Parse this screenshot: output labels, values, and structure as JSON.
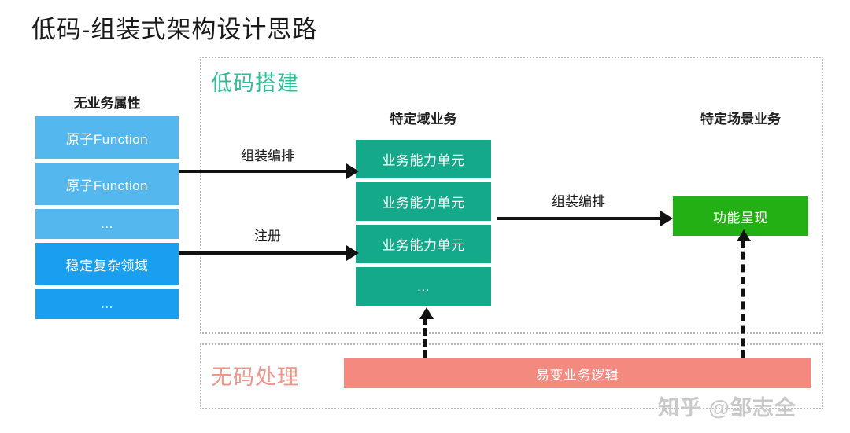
{
  "page": {
    "title": "低码-组装式架构设计思路",
    "background_color": "#ffffff",
    "watermark": "知乎 @邹志全"
  },
  "regions": {
    "lowcode": {
      "title": "低码搭建",
      "title_color": "#2fbd97",
      "border_style": "dotted"
    },
    "nocode": {
      "title": "无码处理",
      "title_color": "#f1948a",
      "border_style": "dotted"
    }
  },
  "columns": {
    "left": {
      "heading": "无业务属性",
      "boxes": [
        {
          "label": "原子Function",
          "color": "#54b8ee"
        },
        {
          "label": "原子Function",
          "color": "#54b8ee"
        },
        {
          "label": "...",
          "color": "#54b8ee"
        },
        {
          "label": "稳定复杂领域",
          "color": "#1a9ef0"
        },
        {
          "label": "...",
          "color": "#1a9ef0"
        }
      ]
    },
    "middle": {
      "heading": "特定域业务",
      "boxes": [
        {
          "label": "业务能力单元",
          "color": "#13a98a"
        },
        {
          "label": "业务能力单元",
          "color": "#13a98a"
        },
        {
          "label": "业务能力单元",
          "color": "#13a98a"
        },
        {
          "label": "...",
          "color": "#13a98a"
        }
      ]
    },
    "right": {
      "heading": "特定场景业务",
      "boxes": [
        {
          "label": "功能呈现",
          "color": "#22b014"
        }
      ]
    }
  },
  "bottom_bar": {
    "label": "易变业务逻辑",
    "color": "#f4897f"
  },
  "arrows": [
    {
      "name": "assemble-1",
      "label": "组装编排",
      "style": "solid",
      "direction": "right"
    },
    {
      "name": "register",
      "label": "注册",
      "style": "solid",
      "direction": "right"
    },
    {
      "name": "assemble-2",
      "label": "组装编排",
      "style": "solid",
      "direction": "right"
    },
    {
      "name": "volatile-to-domain",
      "label": "",
      "style": "dashed",
      "direction": "up"
    },
    {
      "name": "volatile-to-function",
      "label": "",
      "style": "dashed",
      "direction": "up"
    }
  ]
}
